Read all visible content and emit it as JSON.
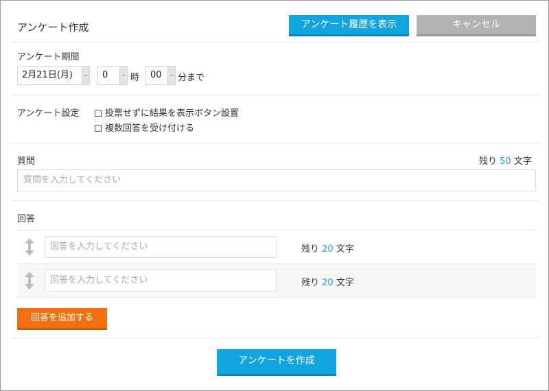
{
  "header": {
    "title": "アンケート作成",
    "history_button": "アンケート履歴を表示",
    "cancel_button": "キャンセル"
  },
  "period": {
    "label": "アンケート期間",
    "date_value": "2月21日(月)",
    "hour_value": "0",
    "hour_suffix": "時",
    "minute_value": "00",
    "minute_suffix": "分まで"
  },
  "settings": {
    "label": "アンケート設定",
    "options": [
      {
        "label": "投票せずに結果を表示ボタン設置",
        "checked": false
      },
      {
        "label": "複数回答を受け付ける",
        "checked": false
      }
    ]
  },
  "question": {
    "label": "質問",
    "remaining_prefix": "残り",
    "remaining_count": "50",
    "remaining_suffix": "文字",
    "placeholder": "質問を入力してください"
  },
  "answers": {
    "label": "回答",
    "items": [
      {
        "placeholder": "回答を入力してください",
        "remaining_prefix": "残り",
        "remaining_count": "20",
        "remaining_suffix": "文字"
      },
      {
        "placeholder": "回答を入力してください",
        "remaining_prefix": "残り",
        "remaining_count": "20",
        "remaining_suffix": "文字"
      }
    ],
    "add_button": "回答を追加する"
  },
  "footer": {
    "create_button": "アンケートを作成"
  },
  "colors": {
    "accent_blue": "#12a3e1",
    "cancel_gray": "#b3b3b3",
    "add_orange": "#f27011",
    "count_blue": "#1d9fc9"
  },
  "icons": {
    "select_arrow": "chevron-down-icon",
    "drag_handle": "drag-handle-icon",
    "checkbox": "checkbox-icon"
  }
}
